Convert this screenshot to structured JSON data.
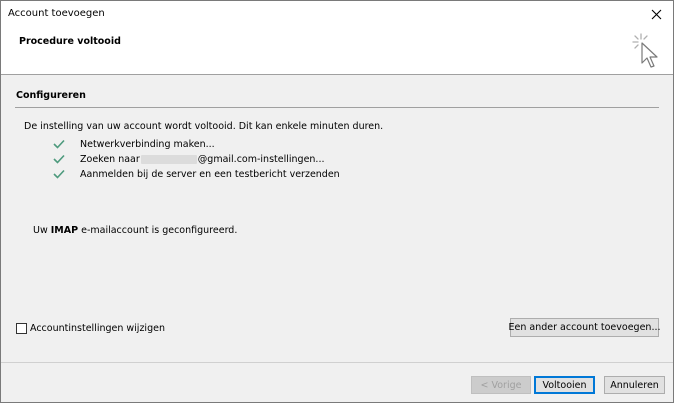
{
  "window": {
    "title": "Account toevoegen",
    "close_icon": "close-icon"
  },
  "header": {
    "title": "Procedure voltooid",
    "icon": "wizard-cursor-icon"
  },
  "section": {
    "title": "Configureren",
    "intro": "De instelling van uw account wordt voltooid. Dit kan enkele minuten duren."
  },
  "steps": [
    {
      "icon": "checkmark-icon",
      "label": "Netwerkverbinding maken..."
    },
    {
      "icon": "checkmark-icon",
      "label_prefix": "Zoeken naar",
      "label_suffix": "@gmail.com-instellingen..."
    },
    {
      "icon": "checkmark-icon",
      "label": "Aanmelden bij de server en een testbericht verzenden"
    }
  ],
  "status": {
    "prefix": "Uw",
    "bold": "IMAP",
    "suffix": "e-mailaccount is geconfigureerd."
  },
  "options": {
    "change_settings_label": "Accountinstellingen wijzigen",
    "change_settings_checked": false,
    "add_another_label": "Een ander account toevoegen..."
  },
  "buttons": {
    "back": "< Vorige",
    "finish": "Voltooien",
    "cancel": "Annuleren"
  },
  "colors": {
    "check_green": "#4d9a7d",
    "default_button_border": "#0078d7"
  }
}
